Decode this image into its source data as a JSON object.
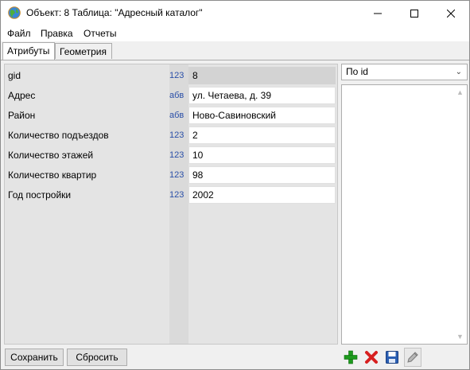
{
  "window": {
    "title": "Объект: 8 Таблица: \"Адресный каталог\"",
    "controls": [
      "minimize-icon",
      "maximize-icon",
      "close-icon"
    ]
  },
  "menu": [
    {
      "label": "Файл"
    },
    {
      "label": "Правка"
    },
    {
      "label": "Отчеты"
    }
  ],
  "tabs": [
    {
      "label": "Атрибуты",
      "active": true
    },
    {
      "label": "Геометрия",
      "active": false
    }
  ],
  "attributes": [
    {
      "label": "gid",
      "type": "123",
      "value": "8",
      "readonly": true
    },
    {
      "label": "Адрес",
      "type": "абв",
      "value": "ул. Четаева, д. 39"
    },
    {
      "label": "Район",
      "type": "абв",
      "value": "Ново-Савиновский"
    },
    {
      "label": "Количество подъездов",
      "type": "123",
      "value": "2"
    },
    {
      "label": "Количество этажей",
      "type": "123",
      "value": "10"
    },
    {
      "label": "Количество квартир",
      "type": "123",
      "value": "98"
    },
    {
      "label": "Год постройки",
      "type": "123",
      "value": "2002"
    }
  ],
  "sort_combo": {
    "selected": "По id"
  },
  "buttons": {
    "save": "Сохранить",
    "reset": "Сбросить"
  },
  "toolbar_icons": [
    "add-icon",
    "delete-icon",
    "save-icon",
    "edit-icon"
  ],
  "colors": {
    "add": "#1e9a1e",
    "delete": "#d71f1f",
    "save": "#2b5fb3",
    "type_label": "#2a4fa8"
  }
}
